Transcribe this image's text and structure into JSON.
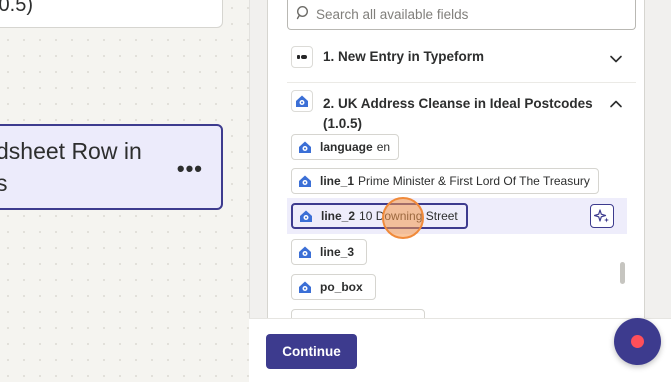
{
  "canvas": {
    "top_card": {
      "version_text": ".0.5)"
    },
    "active_card": {
      "title_line1": "dsheet Row in",
      "title_line2": "s",
      "more_label": "•••"
    }
  },
  "panel": {
    "search": {
      "placeholder": "Search all available fields"
    },
    "steps": [
      {
        "label": "1. New Entry in Typeform",
        "icon": "typeform-icon",
        "expanded": false
      },
      {
        "label": "2. UK Address Cleanse in Ideal Postcodes (1.0.5)",
        "icon": "ideal-postcodes-icon",
        "expanded": true
      }
    ],
    "fields": [
      {
        "name": "language",
        "value": "en"
      },
      {
        "name": "line_1",
        "value": "Prime Minister & First Lord Of The Treasury"
      },
      {
        "name": "line_2",
        "value": "10 Downing Street",
        "selected": true
      },
      {
        "name": "line_3",
        "value": ""
      },
      {
        "name": "po_box",
        "value": ""
      }
    ]
  },
  "footer": {
    "continue_label": "Continue"
  },
  "colors": {
    "accent": "#3d3b8e",
    "brand_icon": "#3b6fd6",
    "cursor": "#f08a3a",
    "help_dot": "#ff4f5a"
  }
}
